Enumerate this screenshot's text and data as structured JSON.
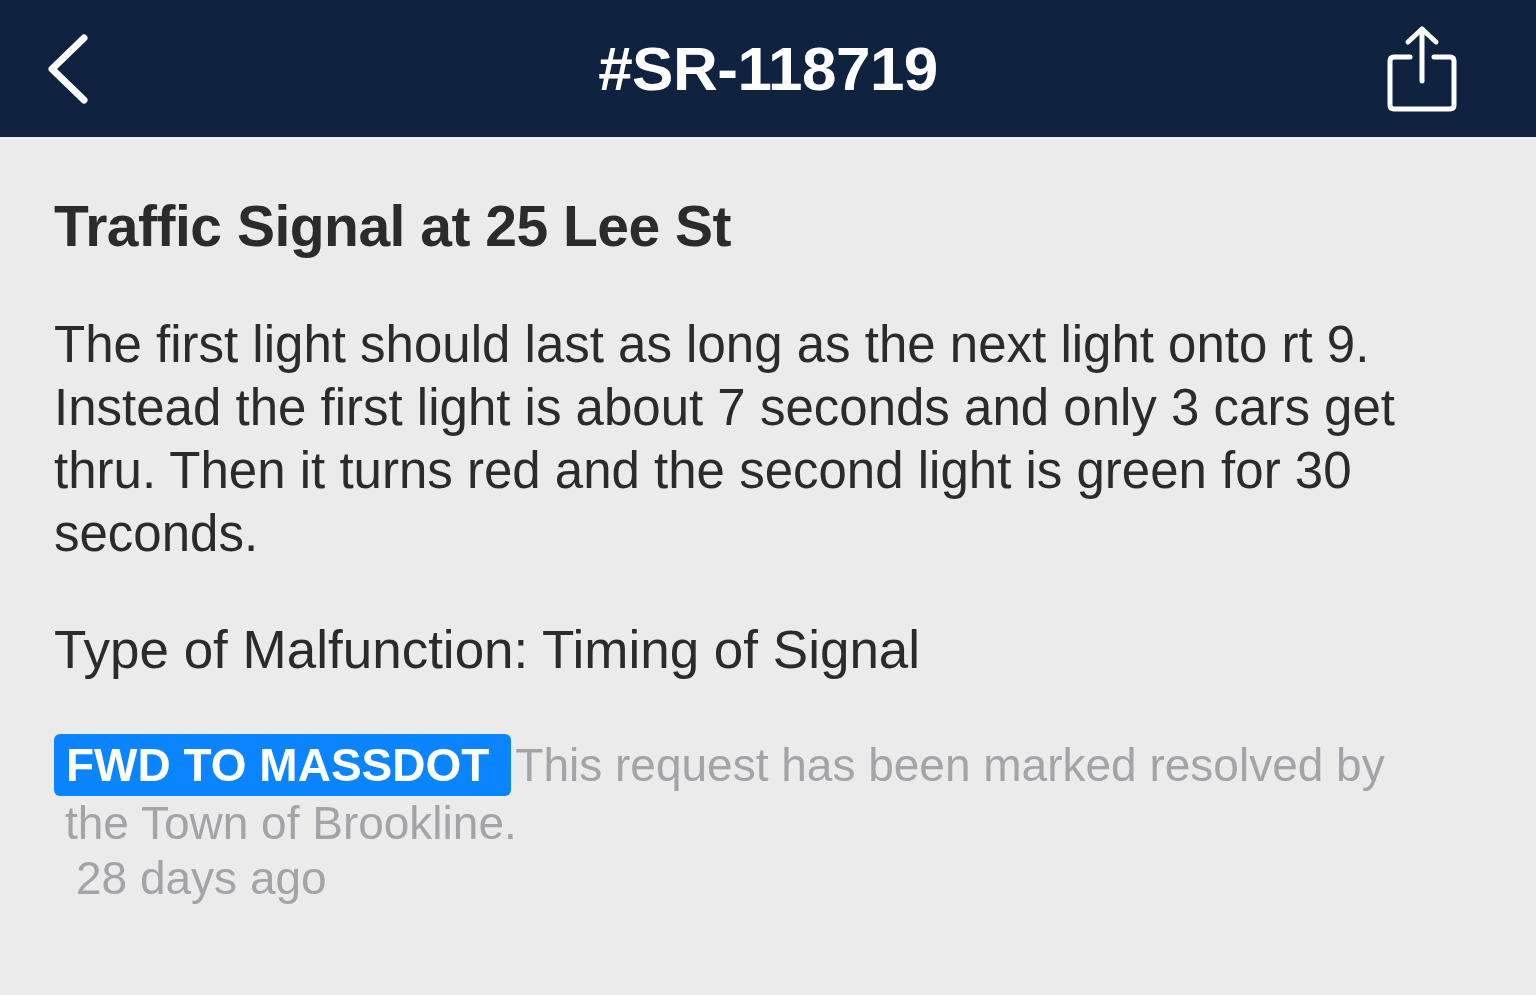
{
  "header": {
    "title": "#SR-118719"
  },
  "request": {
    "title": "Traffic Signal at 25 Lee St",
    "description": "The first light should last as long as the next light onto rt 9. Instead the first light is about 7 seconds and only 3 cars get thru. Then it turns red and the second light is green for 30 seconds.",
    "malfunction": "Type of Malfunction: Timing of Signal"
  },
  "status": {
    "badge": "FWD TO MASSDOT",
    "message_lines": [
      "This request has been marked resolved by",
      "the Town of Brookline."
    ],
    "time": "28 days ago"
  }
}
